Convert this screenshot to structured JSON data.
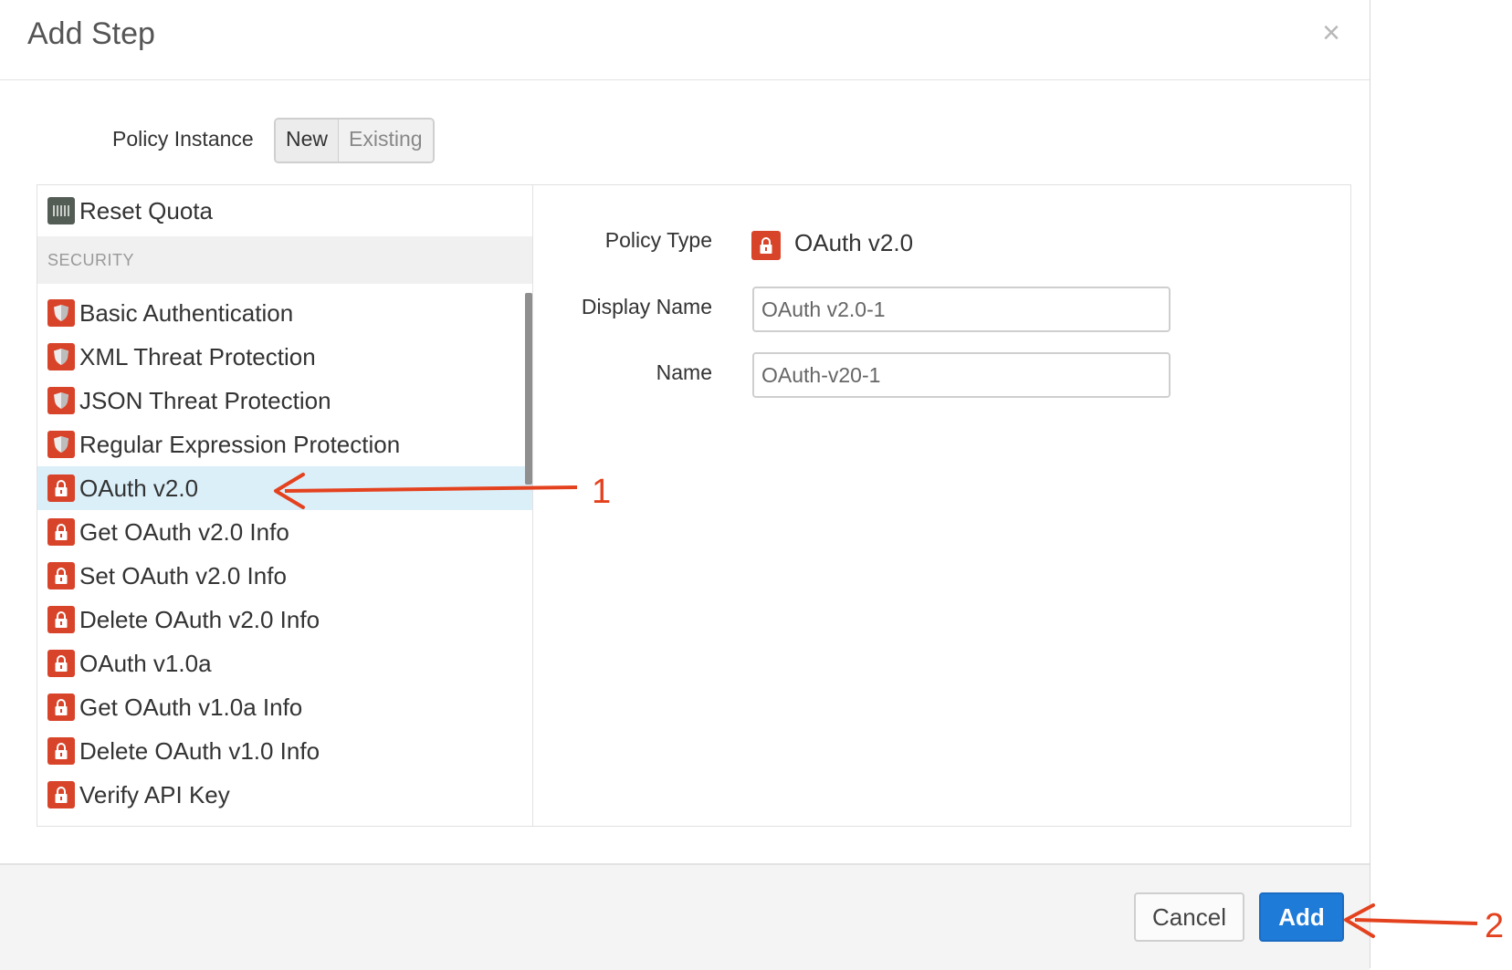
{
  "dialog": {
    "title": "Add Step",
    "close_symbol": "×"
  },
  "policy_instance": {
    "label": "Policy Instance",
    "options": [
      "New",
      "Existing"
    ],
    "selected": "New"
  },
  "policy_list": {
    "items": [
      {
        "label": "Reset Quota",
        "icon": "quota-icon"
      },
      {
        "label": "Basic Authentication",
        "icon": "shield-icon"
      },
      {
        "label": "XML Threat Protection",
        "icon": "shield-icon"
      },
      {
        "label": "JSON Threat Protection",
        "icon": "shield-icon"
      },
      {
        "label": "Regular Expression Protection",
        "icon": "shield-icon"
      },
      {
        "label": "OAuth v2.0",
        "icon": "lock-icon",
        "selected": true
      },
      {
        "label": "Get OAuth v2.0 Info",
        "icon": "lock-icon"
      },
      {
        "label": "Set OAuth v2.0 Info",
        "icon": "lock-icon"
      },
      {
        "label": "Delete OAuth v2.0 Info",
        "icon": "lock-icon"
      },
      {
        "label": "OAuth v1.0a",
        "icon": "lock-icon"
      },
      {
        "label": "Get OAuth v1.0a Info",
        "icon": "lock-icon"
      },
      {
        "label": "Delete OAuth v1.0 Info",
        "icon": "lock-icon"
      },
      {
        "label": "Verify API Key",
        "icon": "lock-icon"
      }
    ],
    "section_header": "SECURITY"
  },
  "details": {
    "policy_type_label": "Policy Type",
    "policy_type_value": "OAuth v2.0",
    "display_name_label": "Display Name",
    "display_name_value": "OAuth v2.0-1",
    "name_label": "Name",
    "name_value": "OAuth-v20-1"
  },
  "footer": {
    "cancel_label": "Cancel",
    "add_label": "Add"
  },
  "annotations": {
    "marker_1": "1",
    "marker_2": "2"
  },
  "colors": {
    "security_icon": "#d8442a",
    "quota_icon": "#545c56",
    "selected_row": "#dbeff9",
    "primary_button": "#1f7bd8",
    "annotation": "#e4421f"
  }
}
